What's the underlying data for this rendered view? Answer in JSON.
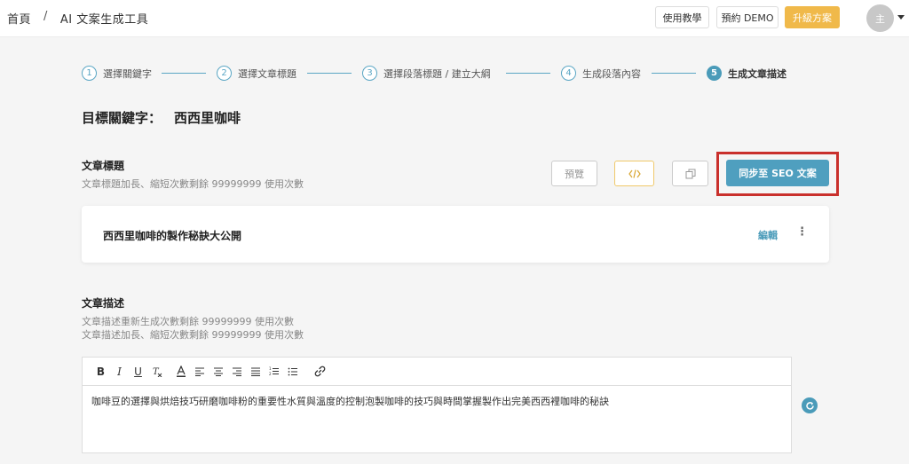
{
  "breadcrumb": {
    "home": "首頁",
    "separator": "/",
    "current": "AI 文案生成工具"
  },
  "header": {
    "tutorial": "使用教學",
    "demo": "預約 DEMO",
    "upgrade": "升級方案",
    "avatar": "主"
  },
  "steps": [
    {
      "num": "1",
      "label": "選擇關鍵字"
    },
    {
      "num": "2",
      "label": "選擇文章標題"
    },
    {
      "num": "3",
      "label": "選擇段落標題 / 建立大綱"
    },
    {
      "num": "4",
      "label": "生成段落內容"
    },
    {
      "num": "5",
      "label": "生成文章描述"
    }
  ],
  "keyword": {
    "label": "目標關鍵字：",
    "value": "西西里咖啡"
  },
  "title_section": {
    "heading": "文章標題",
    "sub": "文章標題加長、縮短次數剩餘 99999999 使用次數",
    "preview": "預覽",
    "sync": "同步至 SEO 文案",
    "card_title": "西西里咖啡的製作秘訣大公開",
    "edit": "編輯"
  },
  "desc_section": {
    "heading": "文章描述",
    "sub1": "文章描述重新生成次數剩餘 99999999 使用次數",
    "sub2": "文章描述加長、縮短次數剩餘 99999999 使用次數",
    "content": "咖啡豆的選擇與烘焙技巧研磨咖啡粉的重要性水質與溫度的控制泡製咖啡的技巧與時間掌握製作出完美西西裡咖啡的秘訣"
  },
  "colors": {
    "accent": "#4a9bb9",
    "upgrade": "#f0b94a",
    "highlight": "#c9302c"
  }
}
